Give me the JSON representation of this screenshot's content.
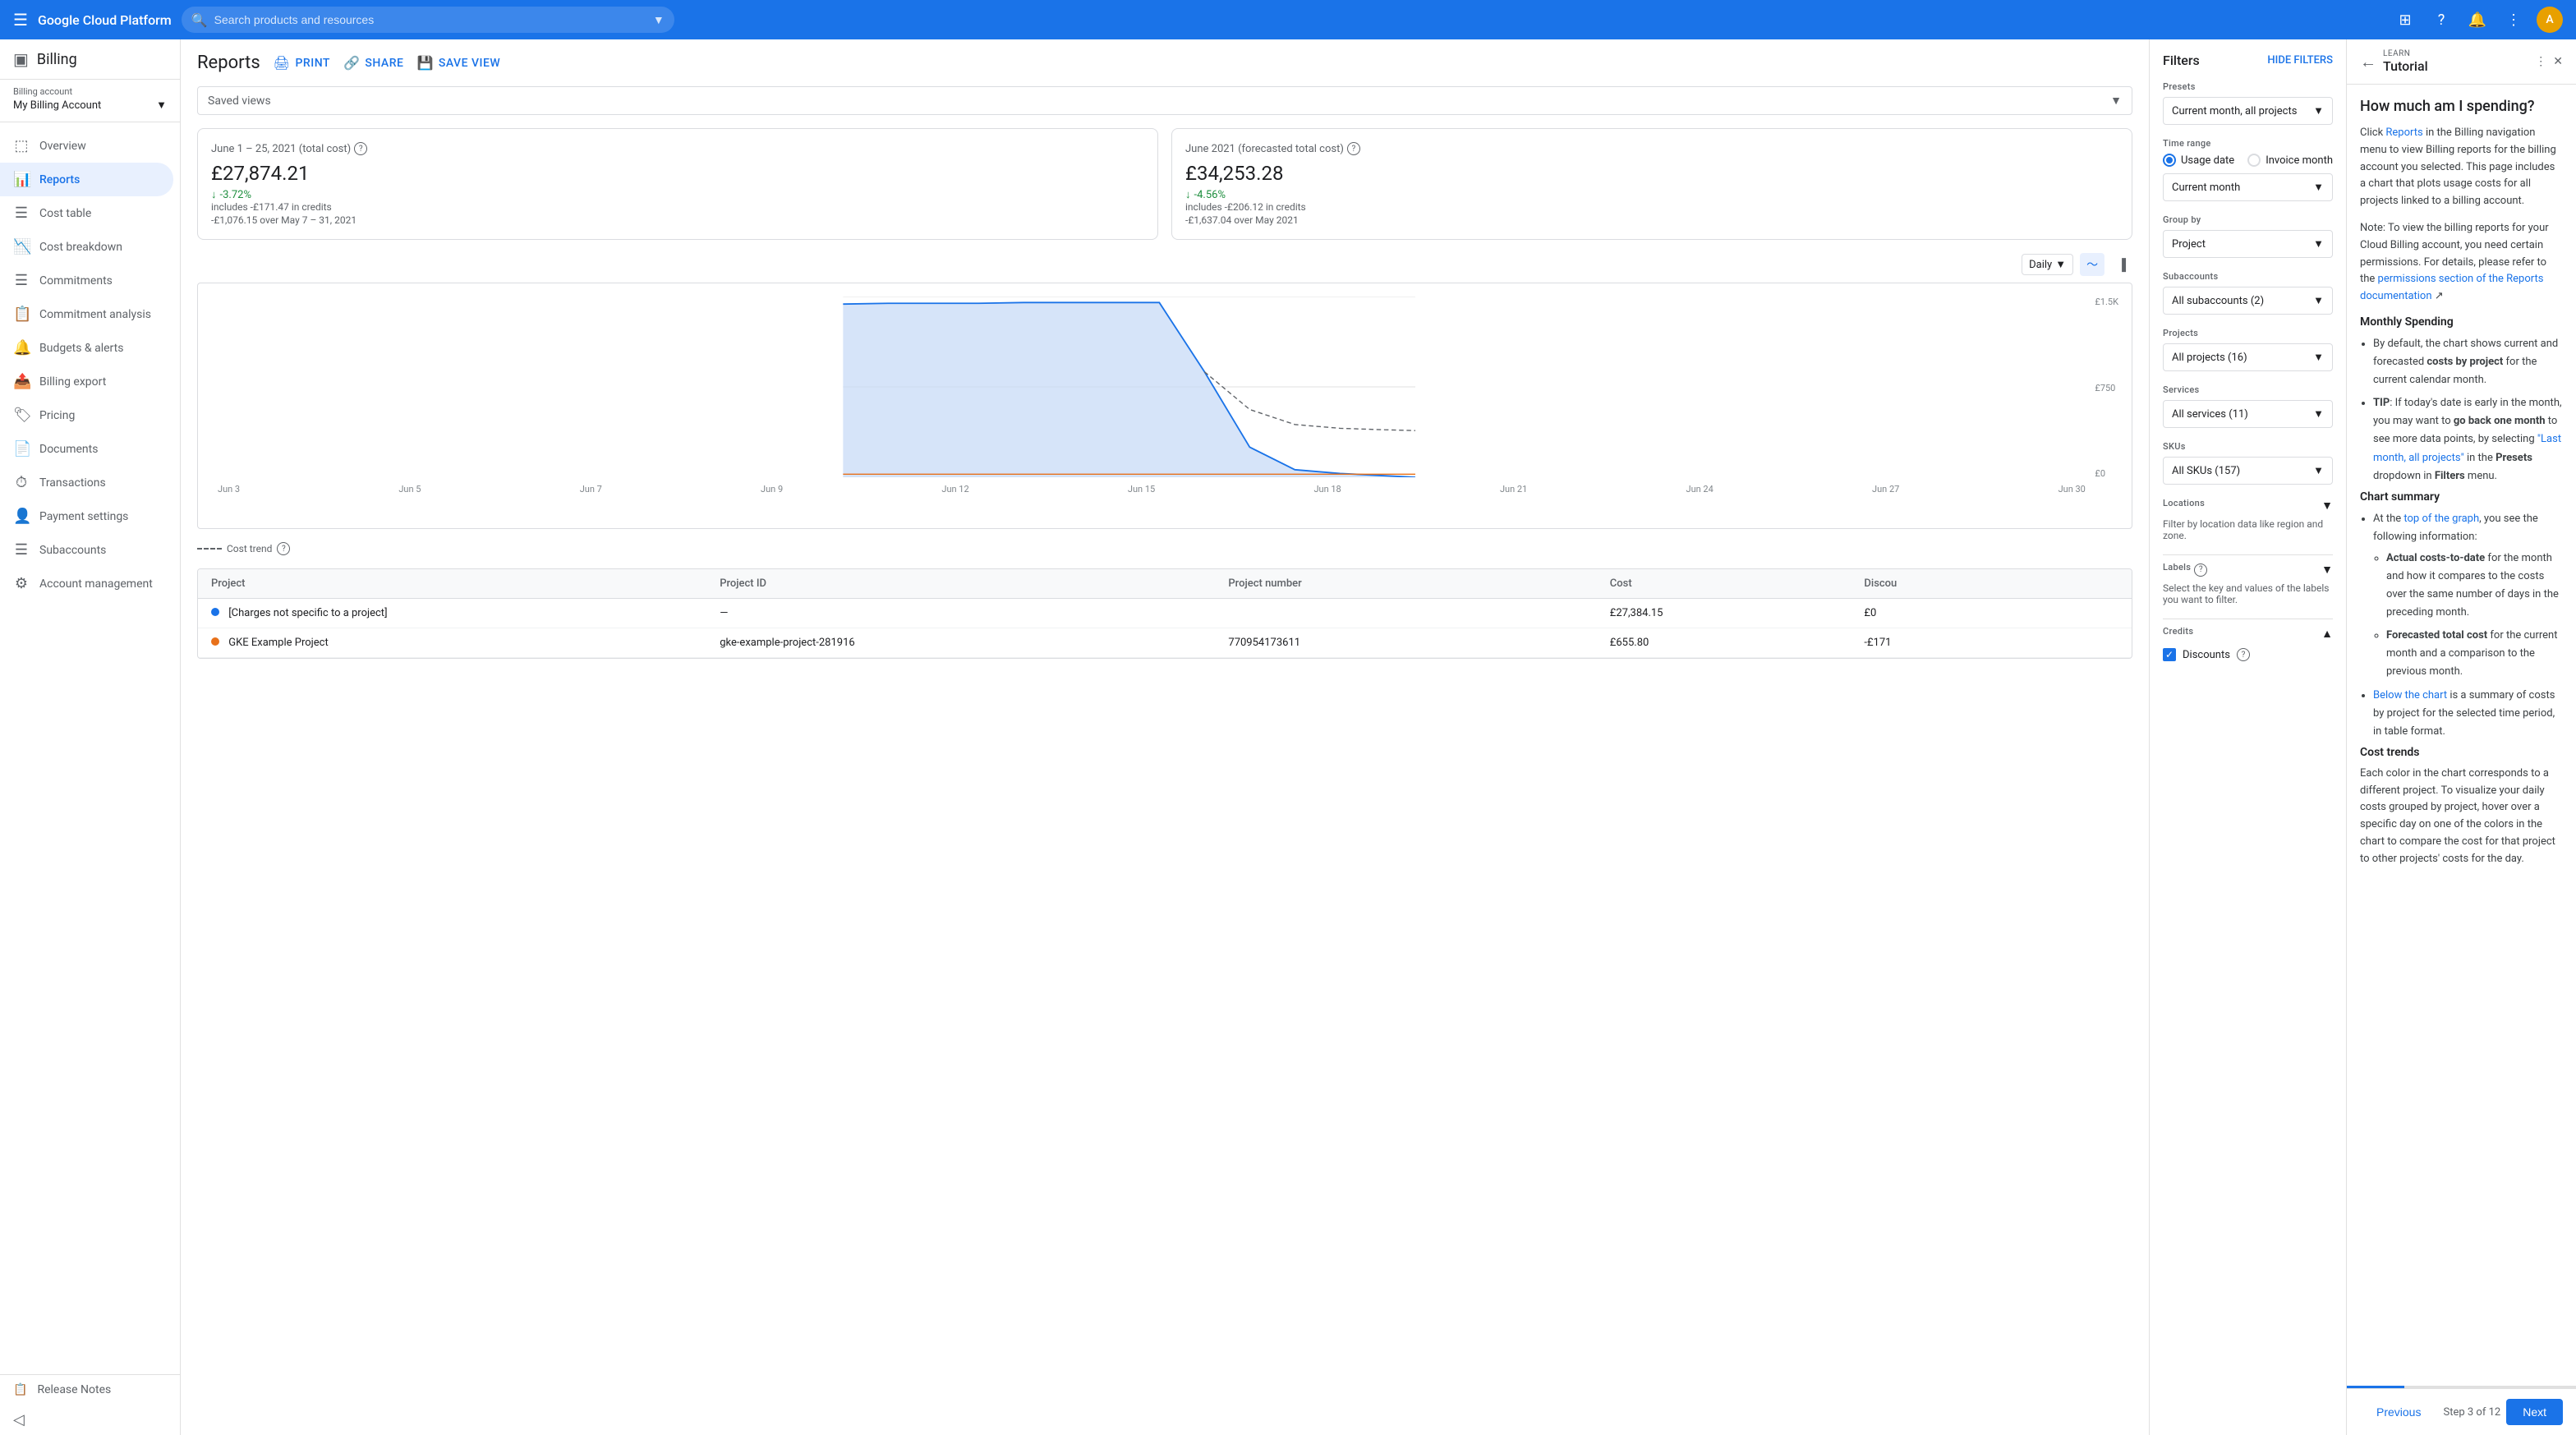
{
  "topbar": {
    "menu_icon": "☰",
    "logo": "Google Cloud Platform",
    "search_placeholder": "Search products and resources",
    "avatar_initial": "A"
  },
  "sidebar": {
    "header": {
      "icon": "💳",
      "title": "Billing"
    },
    "billing_account": {
      "label": "Billing account",
      "value": "My Billing Account"
    },
    "nav_items": [
      {
        "id": "overview",
        "icon": "⬚",
        "label": "Overview",
        "active": false
      },
      {
        "id": "reports",
        "icon": "📊",
        "label": "Reports",
        "active": true
      },
      {
        "id": "cost-table",
        "icon": "☰",
        "label": "Cost table",
        "active": false
      },
      {
        "id": "cost-breakdown",
        "icon": "📉",
        "label": "Cost breakdown",
        "active": false
      },
      {
        "id": "commitments",
        "icon": "☰",
        "label": "Commitments",
        "active": false
      },
      {
        "id": "commitment-analysis",
        "icon": "📋",
        "label": "Commitment analysis",
        "active": false
      },
      {
        "id": "budgets-alerts",
        "icon": "🔔",
        "label": "Budgets & alerts",
        "active": false
      },
      {
        "id": "billing-export",
        "icon": "📤",
        "label": "Billing export",
        "active": false
      },
      {
        "id": "pricing",
        "icon": "🏷",
        "label": "Pricing",
        "active": false
      },
      {
        "id": "documents",
        "icon": "📄",
        "label": "Documents",
        "active": false
      },
      {
        "id": "transactions",
        "icon": "⏱",
        "label": "Transactions",
        "active": false
      },
      {
        "id": "payment-settings",
        "icon": "👤",
        "label": "Payment settings",
        "active": false
      },
      {
        "id": "subaccounts",
        "icon": "☰",
        "label": "Subaccounts",
        "active": false
      },
      {
        "id": "account-management",
        "icon": "⚙",
        "label": "Account management",
        "active": false
      }
    ],
    "footer": {
      "release_notes": "Release Notes"
    }
  },
  "reports": {
    "title": "Reports",
    "actions": {
      "print": "PRINT",
      "share": "SHARE",
      "save_view": "SAVE VIEW"
    },
    "saved_views_label": "Saved views",
    "summary": {
      "actual": {
        "title": "June 1 – 25, 2021 (total cost)",
        "amount": "£27,874.21",
        "change_pct": "-3.72%",
        "credits_note": "includes -£171.47 in credits",
        "comparison": "-£1,076.15 over May 7 – 31, 2021"
      },
      "forecast": {
        "title": "June 2021 (forecasted total cost)",
        "amount": "£34,253.28",
        "change_pct": "-4.56%",
        "credits_note": "includes -£206.12 in credits",
        "comparison": "-£1,637.04 over May 2021"
      }
    },
    "chart": {
      "interval_label": "Daily",
      "y_labels": [
        "£1.5K",
        "£750",
        "£0"
      ],
      "x_labels": [
        "Jun 3",
        "Jun 5",
        "Jun 7",
        "Jun 9",
        "Jun 12",
        "Jun 15",
        "Jun 18",
        "Jun 21",
        "Jun 24",
        "Jun 27",
        "Jun 30"
      ],
      "cost_trend_label": "Cost trend"
    },
    "table": {
      "headers": [
        "Project",
        "Project ID",
        "Project number",
        "Cost",
        "Discou"
      ],
      "rows": [
        {
          "project": "[Charges not specific to a project]",
          "project_id": "—",
          "project_number": "",
          "cost": "£27,384.15",
          "discount": "£0",
          "dot_color": "#1a73e8"
        },
        {
          "project": "GKE Example Project",
          "project_id": "gke-example-project-281916",
          "project_number": "770954173611",
          "cost": "£655.80",
          "discount": "-£171",
          "dot_color": "#e8711a"
        }
      ]
    }
  },
  "filters": {
    "title": "Filters",
    "hide_filters_btn": "HIDE FILTERS",
    "presets": {
      "label": "Presets",
      "value": "Current month, all projects"
    },
    "time_range": {
      "label": "Time range",
      "options": [
        "Usage date",
        "Invoice month"
      ],
      "selected": "Usage date"
    },
    "time_range_dropdown": "Current month",
    "group_by": {
      "label": "Group by",
      "value": "Project"
    },
    "subaccounts": {
      "label": "Subaccounts",
      "value": "All subaccounts (2)"
    },
    "projects": {
      "label": "Projects",
      "value": "All projects (16)"
    },
    "services": {
      "label": "Services",
      "value": "All services (11)"
    },
    "skus": {
      "label": "SKUs",
      "value": "All SKUs (157)"
    },
    "locations": {
      "label": "Locations",
      "desc": "Filter by location data like region and zone."
    },
    "labels": {
      "label": "Labels",
      "desc": "Select the key and values of the labels you want to filter."
    },
    "credits": {
      "label": "Credits",
      "discounts_label": "Discounts"
    }
  },
  "tutorial": {
    "learn_label": "LEARN",
    "title": "Tutorial",
    "main_title": "How much am I spending?",
    "intro": "Click Reports in the Billing navigation menu to view Billing reports for the billing account you selected. This page includes a chart that plots usage costs for all projects linked to a billing account.",
    "note": "Note: To view the billing reports for your Cloud Billing account, you need certain permissions. For details, please refer to the permissions section of the Reports documentation",
    "monthly_spending_title": "Monthly Spending",
    "monthly_spending_bullets": [
      "By default, the chart shows current and forecasted costs by project for the current calendar month.",
      "TIP: If today's date is early in the month, you may want to go back one month to see more data points, by selecting \"Last month, all projects\" in the Presets dropdown in Filters menu."
    ],
    "chart_summary_title": "Chart summary",
    "chart_summary_bullets": [
      "At the top of the graph, you see the following information:",
      "Actual costs-to-date for the month and how it compares to the costs over the same number of days in the preceding month.",
      "Forecasted total cost for the current month and a comparison to the previous month.",
      "Below the chart is a summary of costs by project for the selected time period, in table format."
    ],
    "cost_trends_title": "Cost trends",
    "cost_trends_text": "Each color in the chart corresponds to a different project. To visualize your daily costs grouped by project, hover over a specific day on one of the colors in the chart to compare the cost for that project to other projects' costs for the day.",
    "footer": {
      "prev_btn": "Previous",
      "step_label": "Step 3 of 12",
      "next_btn": "Next"
    }
  }
}
